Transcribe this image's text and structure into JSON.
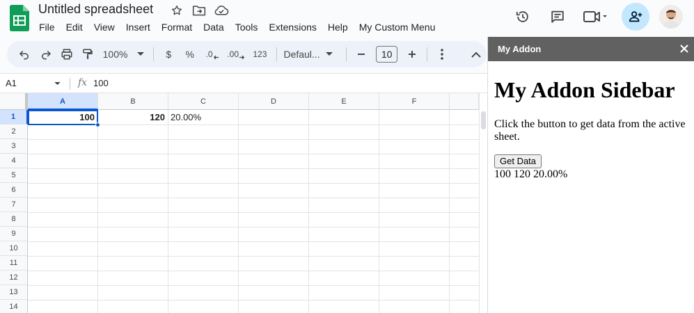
{
  "app": {
    "doc_title": "Untitled spreadsheet",
    "menus": [
      "File",
      "Edit",
      "View",
      "Insert",
      "Format",
      "Data",
      "Tools",
      "Extensions",
      "Help",
      "My Custom Menu"
    ],
    "icons": {
      "logo": "google-sheets-logo",
      "star": "star-icon",
      "move": "folder-move-icon",
      "cloud": "cloud-saved-icon",
      "history": "history-icon",
      "comments": "comment-icon",
      "meet": "video-camera-icon",
      "share": "add-person-icon"
    },
    "colors": {
      "accent": "#0b57d0",
      "share_bg": "#c2e7ff",
      "sheets_green": "#0f9d58",
      "sidebar_header": "#616161"
    }
  },
  "toolbar": {
    "zoom": "100%",
    "currency": "$",
    "percent": "%",
    "decrease_decimal": ".0",
    "increase_decimal": ".00",
    "number_format": "123",
    "font": "Defaul...",
    "font_size": "10"
  },
  "formula_bar": {
    "name_box": "A1",
    "fx": "fx",
    "value": "100"
  },
  "grid": {
    "columns": [
      "A",
      "B",
      "C",
      "D",
      "E",
      "F"
    ],
    "rows": [
      "1",
      "2",
      "3",
      "4",
      "5",
      "6",
      "7",
      "8",
      "9",
      "10",
      "11",
      "12",
      "13",
      "14"
    ],
    "selected_column": "A",
    "selected_row": "1",
    "cells": {
      "A1": "100",
      "B1": "120",
      "C1": "20.00%"
    }
  },
  "sidebar": {
    "title": "My Addon",
    "heading": "My Addon Sidebar",
    "description": "Click the button to get data from the active sheet.",
    "button_label": "Get Data",
    "result": "100 120 20.00%"
  }
}
